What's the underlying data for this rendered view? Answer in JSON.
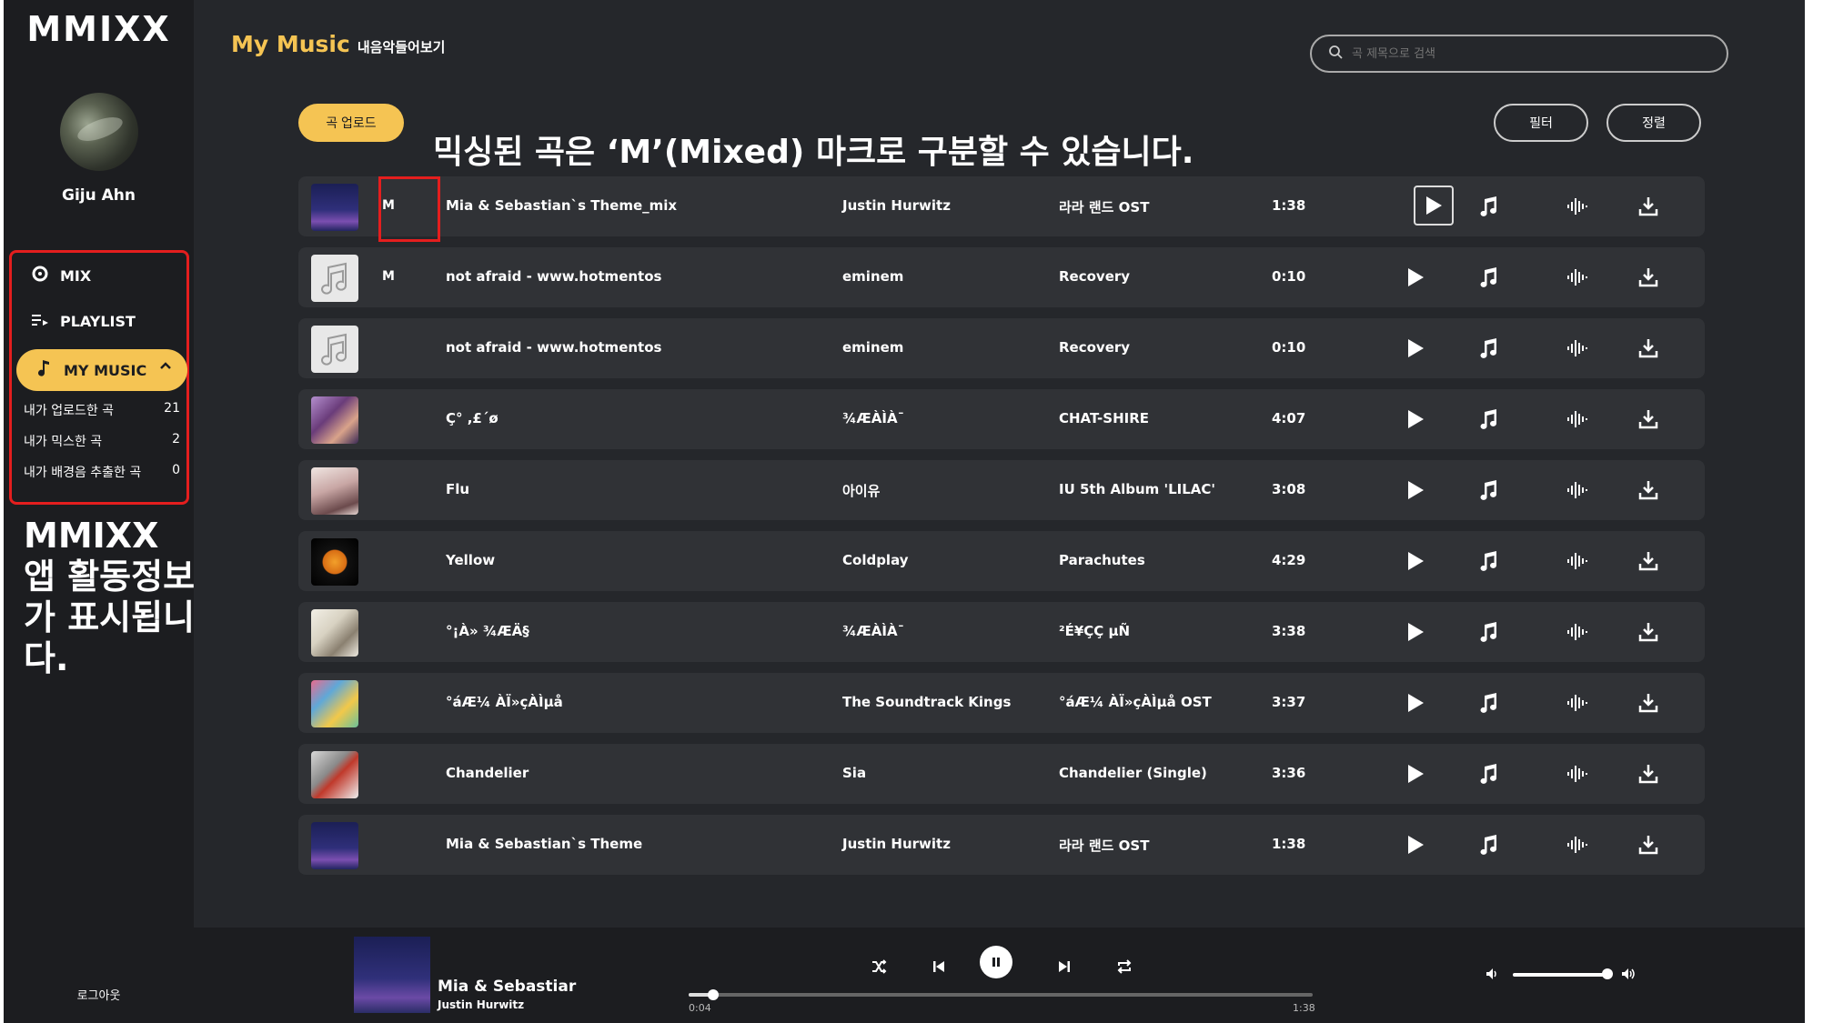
{
  "sidebar": {
    "logo": "MMIXX",
    "username": "Giju Ahn",
    "menu": {
      "mix": "MIX",
      "playlist": "PLAYLIST",
      "my_music": "MY MUSIC"
    },
    "stats": [
      {
        "label": "내가 업로드한 곡",
        "count": "21"
      },
      {
        "label": "내가 믹스한 곡",
        "count": "2"
      },
      {
        "label": "내가 배경음 추출한 곡",
        "count": "0"
      }
    ],
    "caption": "MMIXX 앱 활동정보가 표시됩니다.",
    "logout": "로그아웃"
  },
  "header": {
    "title": "My Music",
    "subtitle": "내음악들어보기",
    "search_placeholder": "곡 제목으로 검색"
  },
  "toolbar": {
    "upload": "곡 업로드",
    "filter": "필터",
    "sort": "정렬"
  },
  "annotation": "믹싱된 곡은 ‘M’(Mixed) 마크로 구분할 수 있습니다.",
  "songs": [
    {
      "mark": "M",
      "title": "Mia & Sebastian`s Theme_mix",
      "artist": "Justin Hurwitz",
      "album": "라라 랜드 OST",
      "duration": "1:38"
    },
    {
      "mark": "M",
      "title": "not afraid - www.hotmentos",
      "artist": "eminem",
      "album": "Recovery",
      "duration": "0:10"
    },
    {
      "mark": "",
      "title": "not afraid - www.hotmentos",
      "artist": "eminem",
      "album": "Recovery",
      "duration": "0:10"
    },
    {
      "mark": "",
      "title": "Ç° ,£´ø",
      "artist": "¾ÆÀÌÀ¯",
      "album": "CHAT-SHIRE",
      "duration": "4:07"
    },
    {
      "mark": "",
      "title": "Flu",
      "artist": "아이유",
      "album": "IU 5th Album 'LILAC'",
      "duration": "3:08"
    },
    {
      "mark": "",
      "title": "Yellow",
      "artist": "Coldplay",
      "album": "Parachutes",
      "duration": "4:29"
    },
    {
      "mark": "",
      "title": "°¡À» ¾ÆÄ§",
      "artist": "¾ÆÀÌÀ¯",
      "album": "²É¥ÇÇ µÑ",
      "duration": "3:38"
    },
    {
      "mark": "",
      "title": "°áÆ¼ ÀÏ»çÀÌµå",
      "artist": "The Soundtrack Kings",
      "album": "°áÆ¼ ÀÏ»çÀÌµå OST",
      "duration": "3:37"
    },
    {
      "mark": "",
      "title": "Chandelier",
      "artist": "Sia",
      "album": "Chandelier (Single)",
      "duration": "3:36"
    },
    {
      "mark": "",
      "title": "Mia & Sebastian`s Theme",
      "artist": "Justin Hurwitz",
      "album": "라라 랜드 OST",
      "duration": "1:38"
    }
  ],
  "player": {
    "title": "Mia & Sebastiar",
    "artist": "Justin Hurwitz",
    "current_time": "0:04",
    "total_time": "1:38",
    "progress": 0.04,
    "volume": 1.0
  },
  "colors": {
    "accent": "#f5c453",
    "annotation_red": "#e41e1e",
    "background": "#25272b",
    "sidebar": "#1c1d20",
    "row": "#303236"
  }
}
